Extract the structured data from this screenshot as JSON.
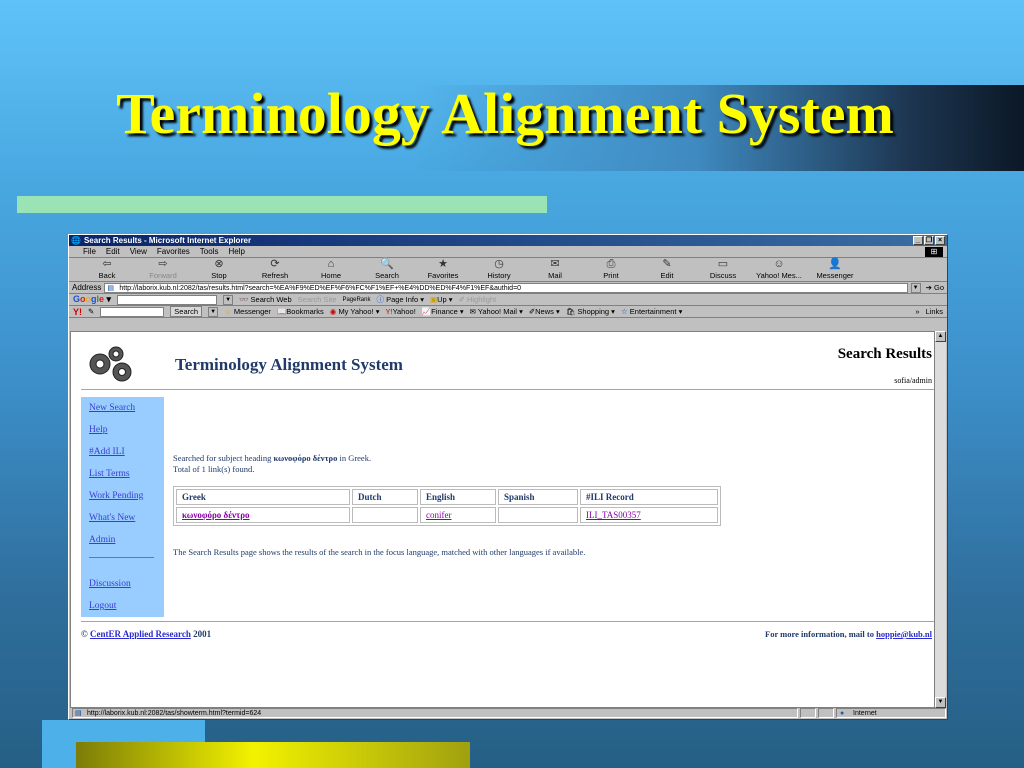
{
  "slide": {
    "title": "Terminology Alignment System"
  },
  "browser": {
    "window_title": "Search Results - Microsoft Internet Explorer",
    "menu": [
      "File",
      "Edit",
      "View",
      "Favorites",
      "Tools",
      "Help"
    ],
    "toolbar": [
      {
        "label": "Back",
        "icon": "back-arrow-icon"
      },
      {
        "label": "Forward",
        "icon": "forward-arrow-icon"
      },
      {
        "label": "Stop",
        "icon": "stop-icon"
      },
      {
        "label": "Refresh",
        "icon": "refresh-icon"
      },
      {
        "label": "Home",
        "icon": "home-icon"
      },
      {
        "label": "Search",
        "icon": "search-icon"
      },
      {
        "label": "Favorites",
        "icon": "favorites-icon"
      },
      {
        "label": "History",
        "icon": "history-icon"
      },
      {
        "label": "Mail",
        "icon": "mail-icon"
      },
      {
        "label": "Print",
        "icon": "print-icon"
      },
      {
        "label": "Edit",
        "icon": "edit-icon"
      },
      {
        "label": "Discuss",
        "icon": "discuss-icon"
      },
      {
        "label": "Yahoo! Mes...",
        "icon": "yahoo-messenger-icon"
      },
      {
        "label": "Messenger",
        "icon": "messenger-icon"
      }
    ],
    "address_label": "Address",
    "url": "http://laborix.kub.nl:2082/tas/results.html?search=%EA%F9%ED%EF%F6%FC%F1%EF+%E4%DD%ED%F4%F1%EF&authid=0",
    "go_label": "Go",
    "google": {
      "logo": "Google",
      "search_web": "Search Web",
      "search_site": "Search Site",
      "pagerank": "PageRank",
      "page_info": "Page Info",
      "up": "Up",
      "highlight": "Highlight"
    },
    "yahoo": {
      "logo": "Y!",
      "search_btn": "Search",
      "items": [
        "Messenger",
        "Bookmarks",
        "My Yahoo!",
        "Yahoo!",
        "Finance",
        "Yahoo! Mail",
        "News",
        "Shopping",
        "Entertainment"
      ],
      "more": "»",
      "links": "Links"
    },
    "status_text": "http://laborix.kub.nl:2082/tas/showterm.html?termid=624",
    "zone": "Internet"
  },
  "page": {
    "app_title": "Terminology Alignment System",
    "results_title": "Search Results",
    "user": "sofia/admin",
    "nav": [
      "New Search",
      "Help",
      "#Add ILI",
      "List Terms",
      "Work Pending",
      "What's New",
      "Admin"
    ],
    "nav2": [
      "Discussion",
      "Logout"
    ],
    "searched_prefix": "Searched for subject heading ",
    "searched_term": "κωνοφόρο δέντρο",
    "searched_suffix": " in Greek.",
    "total": "Total of 1 link(s) found.",
    "table": {
      "headers": [
        "Greek",
        "Dutch",
        "English",
        "Spanish",
        "#ILI Record"
      ],
      "rows": [
        [
          "κωνοφόρο δέντρο",
          "",
          "conifer",
          "",
          "ILI_TAS00357"
        ]
      ]
    },
    "note": "The Search Results page shows the results of the search in the focus language, matched with other languages if available.",
    "footer_copy": "© ",
    "footer_org": "CentER Applied Research",
    "footer_year": " 2001",
    "footer_info": "For more information, mail to ",
    "footer_email": "hoppie@kub.nl"
  }
}
